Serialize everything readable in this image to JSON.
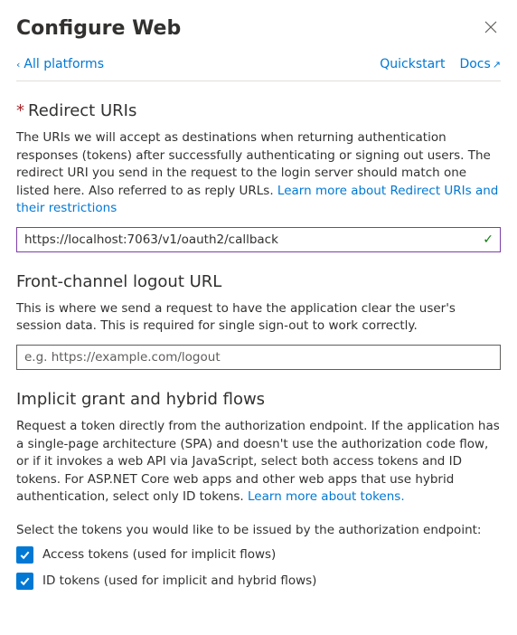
{
  "header": {
    "title": "Configure Web"
  },
  "nav": {
    "back": "All platforms",
    "quickstart": "Quickstart",
    "docs": "Docs"
  },
  "redirect": {
    "heading": "Redirect URIs",
    "desc_part1": "The URIs we will accept as destinations when returning authentication responses (tokens) after successfully authenticating or signing out users. The redirect URI you send in the request to the login server should match one listed here. Also referred to as reply URLs. ",
    "learn_more": "Learn more about Redirect URIs and their restrictions",
    "value": "https://localhost:7063/v1/oauth2/callback"
  },
  "logout": {
    "heading": "Front-channel logout URL",
    "desc": "This is where we send a request to have the application clear the user's session data. This is required for single sign-out to work correctly.",
    "placeholder": "e.g. https://example.com/logout",
    "value": ""
  },
  "implicit": {
    "heading": "Implicit grant and hybrid flows",
    "desc_part1": "Request a token directly from the authorization endpoint. If the application has a single-page architecture (SPA) and doesn't use the authorization code flow, or if it invokes a web API via JavaScript, select both access tokens and ID tokens. For ASP.NET Core web apps and other web apps that use hybrid authentication, select only ID tokens. ",
    "learn_more": "Learn more about tokens.",
    "prompt": "Select the tokens you would like to be issued by the authorization endpoint:",
    "access_label": "Access tokens (used for implicit flows)",
    "access_checked": true,
    "id_label": "ID tokens (used for implicit and hybrid flows)",
    "id_checked": true
  }
}
